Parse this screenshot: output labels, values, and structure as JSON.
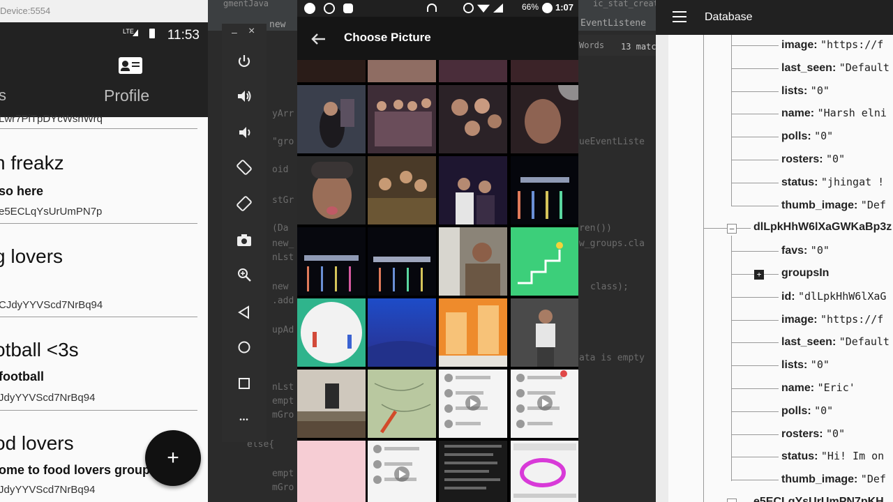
{
  "left_app": {
    "window_title": "Device:5554",
    "clock": "11:53",
    "network": "LTE",
    "tab_left": "s",
    "tab_profile": "Profile",
    "groups": [
      {
        "name": "",
        "sub": "",
        "id": "Lwr7PiTpDYcWsnWrq"
      },
      {
        "name": "n freakz",
        "sub": "so here",
        "id": "e5ECLqYsUrUmPN7p"
      },
      {
        "name": "g lovers",
        "sub": "",
        "id": "CJdyYYVScd7NrBq94"
      },
      {
        "name": "otball <3s",
        "sub": "football",
        "id": "JdyYYVScd7NrBq94"
      },
      {
        "name": "od lovers",
        "sub": "ome to food lovers group",
        "id": "JdyYYVScd7NrBq94"
      }
    ],
    "fab_label": "+"
  },
  "ide": {
    "tab_fragment": "gmentJava",
    "tab_stat": "ic_stat_create.",
    "snippet_new": "new",
    "snippet_eventlistener": "EventListene",
    "search_words": "Words",
    "search_matches": "13 matc",
    "code_lines": [
      {
        "text": "yArr"
      },
      {
        "text": "\"gro"
      },
      {
        "text": "oid"
      },
      {
        "text": "ueEventListe"
      },
      {
        "text": "stGr"
      },
      {
        "text": "(Da"
      },
      {
        "text": "ren())"
      },
      {
        "text": "new_"
      },
      {
        "text": "w_groups.cla"
      },
      {
        "text": "nLst"
      },
      {
        "text": "new"
      },
      {
        "text": "class);"
      },
      {
        "text": ".add"
      },
      {
        "text": "upAd"
      },
      {
        "text": "ata is empty"
      },
      {
        "text": "nLst"
      },
      {
        "text": "empt"
      },
      {
        "text": "mGro"
      },
      {
        "text": "else{"
      },
      {
        "text": "empt"
      },
      {
        "text": "mGro"
      }
    ]
  },
  "emulator_toolbar": {
    "minimize": "–",
    "close": "×",
    "more": "•••",
    "buttons": [
      "power-icon",
      "volume-up-icon",
      "volume-down-icon",
      "rotate-left-icon",
      "rotate-right-icon",
      "camera-icon",
      "zoom-icon",
      "back-icon",
      "home-icon",
      "overview-icon"
    ]
  },
  "phone": {
    "battery": "66%",
    "time": "1:07",
    "title": "Choose Picture"
  },
  "database": {
    "title": "Database",
    "rows": [
      {
        "key": "image",
        "value": "\"https://f"
      },
      {
        "key": "last_seen",
        "value": "\"Default"
      },
      {
        "key": "lists",
        "value": "\"0\""
      },
      {
        "key": "name",
        "value": "\"Harsh elni"
      },
      {
        "key": "polls",
        "value": "\"0\""
      },
      {
        "key": "rosters",
        "value": "\"0\""
      },
      {
        "key": "status",
        "value": "\"jhingat !"
      },
      {
        "key": "thumb_image",
        "value": "\"Def"
      },
      {
        "key": "dlLpkHhW6lXaGWKaBp3z",
        "value": ""
      },
      {
        "key": "favs",
        "value": "\"0\""
      },
      {
        "key": "groupsIn",
        "value": ""
      },
      {
        "key": "id",
        "value": "\"dlLpkHhW6lXaG"
      },
      {
        "key": "image",
        "value": "\"https://f"
      },
      {
        "key": "last_seen",
        "value": "\"Default"
      },
      {
        "key": "lists",
        "value": "\"0\""
      },
      {
        "key": "name",
        "value": "\"Eric'"
      },
      {
        "key": "polls",
        "value": "\"0\""
      },
      {
        "key": "rosters",
        "value": "\"0\""
      },
      {
        "key": "status",
        "value": "\"Hi! Im on"
      },
      {
        "key": "thumb_image",
        "value": "\"Def"
      },
      {
        "key": "e5ECLqYsUrUmPN7pKH",
        "value": ""
      }
    ]
  }
}
